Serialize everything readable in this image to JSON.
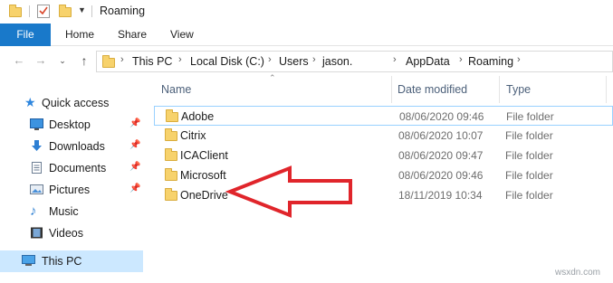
{
  "window": {
    "title": "Roaming"
  },
  "ribbon": {
    "file": "File",
    "tabs": [
      "Home",
      "Share",
      "View"
    ]
  },
  "address": {
    "crumbs": [
      "This PC",
      "Local Disk (C:)",
      "Users",
      "jason.",
      "AppData",
      "Roaming"
    ]
  },
  "sidebar": {
    "items": [
      {
        "label": "Quick access",
        "icon": "star-icon"
      },
      {
        "label": "Desktop",
        "icon": "desktop-icon",
        "pinned": true
      },
      {
        "label": "Downloads",
        "icon": "download-icon",
        "pinned": true
      },
      {
        "label": "Documents",
        "icon": "documents-icon",
        "pinned": true
      },
      {
        "label": "Pictures",
        "icon": "pictures-icon",
        "pinned": true
      },
      {
        "label": "Music",
        "icon": "music-icon"
      },
      {
        "label": "Videos",
        "icon": "videos-icon"
      },
      {
        "label": "This PC",
        "icon": "computer-icon",
        "selected": true
      }
    ]
  },
  "columns": {
    "name": "Name",
    "date": "Date modified",
    "type": "Type"
  },
  "files": [
    {
      "name": "Adobe",
      "date": "08/06/2020 09:46",
      "type": "File folder"
    },
    {
      "name": "Citrix",
      "date": "08/06/2020 10:07",
      "type": "File folder"
    },
    {
      "name": "ICAClient",
      "date": "08/06/2020 09:47",
      "type": "File folder"
    },
    {
      "name": "Microsoft",
      "date": "08/06/2020 09:46",
      "type": "File folder"
    },
    {
      "name": "OneDrive",
      "date": "18/11/2019 10:34",
      "type": "File folder"
    }
  ],
  "colors": {
    "accent": "#1979ca",
    "selection": "#cce8ff",
    "annotation_arrow": "#e0252b"
  },
  "watermark": "wsxdn.com"
}
